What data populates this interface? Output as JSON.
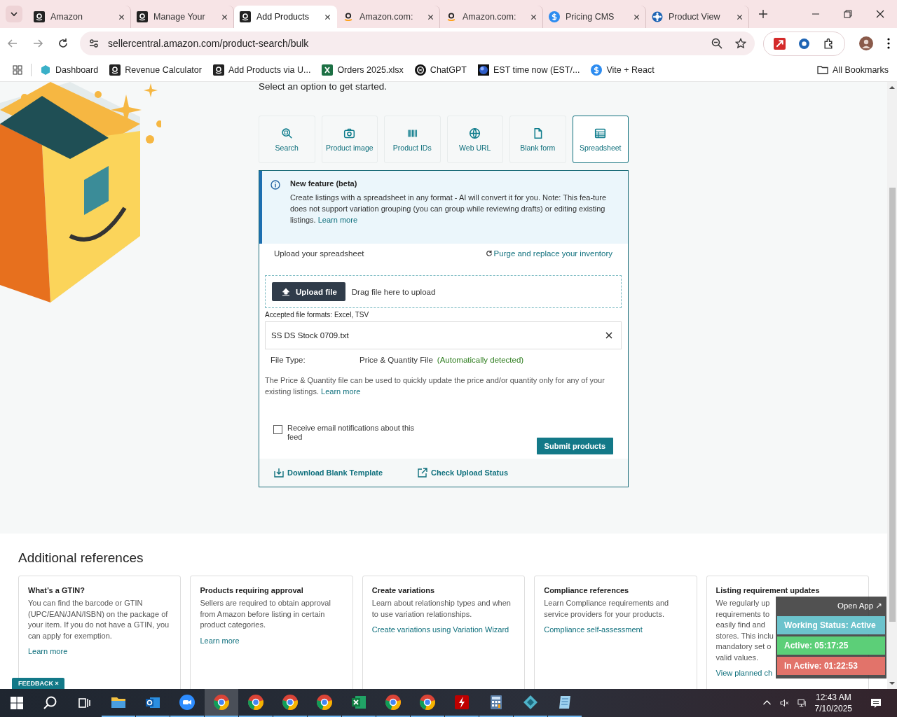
{
  "browser": {
    "tabs": [
      {
        "title": "Amazon",
        "selected": false
      },
      {
        "title": "Manage Your",
        "selected": false
      },
      {
        "title": "Add Products",
        "selected": true
      },
      {
        "title": "Amazon.com:",
        "selected": false
      },
      {
        "title": "Amazon.com:",
        "selected": false
      },
      {
        "title": "Pricing CMS",
        "selected": false
      },
      {
        "title": "Product View",
        "selected": false
      }
    ],
    "url": "sellercentral.amazon.com/product-search/bulk",
    "bookmarks": [
      {
        "label": "Dashboard"
      },
      {
        "label": "Revenue Calculator"
      },
      {
        "label": "Add Products via U..."
      },
      {
        "label": "Orders 2025.xlsx"
      },
      {
        "label": "ChatGPT"
      },
      {
        "label": "EST time now (EST/..."
      },
      {
        "label": "Vite + React"
      }
    ],
    "all_bookmarks": "All Bookmarks"
  },
  "page": {
    "intro": "Select an option to get started.",
    "options": [
      {
        "label": "Search",
        "selected": false
      },
      {
        "label": "Product image",
        "selected": false
      },
      {
        "label": "Product IDs",
        "selected": false
      },
      {
        "label": "Web URL",
        "selected": false
      },
      {
        "label": "Blank form",
        "selected": false
      },
      {
        "label": "Spreadsheet",
        "selected": true
      }
    ],
    "notice": {
      "title": "New feature (beta)",
      "text": "Create listings with a spreadsheet in any format - AI will convert it for you. Note: This fea-ture does not support variation grouping (you can group while reviewing drafts) or editing existing listings.",
      "link": "Learn more"
    },
    "upload": {
      "heading": "Upload your spreadsheet",
      "purge_link": "Purge and replace your inventory",
      "button": "Upload file",
      "drag_text": "Drag file here to upload",
      "accepted": "Accepted file formats: Excel, TSV",
      "file_name": "SS DS Stock 0709.txt",
      "file_type_label": "File Type:",
      "file_type_value": "Price & Quantity File",
      "detected": "(Automatically detected)",
      "description": "The Price & Quantity file can be used to quickly update the price and/or quantity only for any of your existing listings.",
      "learn_more": "Learn more",
      "notify": {
        "label": "Receive email notifications about this feed",
        "checked": false
      },
      "submit": "Submit products",
      "download_link": "Download Blank Template",
      "status_link": "Check Upload Status"
    },
    "references": {
      "title": "Additional references",
      "cards": [
        {
          "title": "What’s a GTIN?",
          "text": "You can find the barcode or GTIN (UPC/EAN/JAN/ISBN) on the package of your item. If you do not have a GTIN, you can apply for exemption.",
          "link": "Learn more"
        },
        {
          "title": "Products requiring approval",
          "text": "Sellers are required to obtain approval from Amazon before listing in certain product categories.",
          "link": "Learn more"
        },
        {
          "title": "Create variations",
          "text": "Learn about relationship types and when to use variation relationships.",
          "link": "Create variations using Variation Wizard"
        },
        {
          "title": "Compliance references",
          "text": "Learn Compliance requirements and service providers for your products.",
          "link": "Compliance self-assessment"
        },
        {
          "title": "Listing requirement updates",
          "lines": [
            "We regularly up",
            "requirements to",
            "easily find and",
            "stores. This inclu",
            "mandatory set o",
            "valid values."
          ],
          "link": "View planned ch"
        }
      ]
    },
    "feedback": "FEEDBACK ×"
  },
  "tracker": {
    "open_app": "Open App ↗",
    "statuses": [
      {
        "text": "Working Status: Active",
        "color": "#6cc3cc"
      },
      {
        "text": "Active: 05:17:25",
        "color": "#5ccf78"
      },
      {
        "text": "In Active: 01:22:53",
        "color": "#e2736a"
      }
    ]
  },
  "taskbar": {
    "apps": [
      {
        "kind": "explorer",
        "selected": false
      },
      {
        "kind": "outlook",
        "selected": false
      },
      {
        "kind": "zoom",
        "selected": false
      },
      {
        "kind": "chrome",
        "selected": true
      },
      {
        "kind": "chrome",
        "selected": false
      },
      {
        "kind": "chrome",
        "selected": false
      },
      {
        "kind": "chrome",
        "selected": false
      },
      {
        "kind": "excel",
        "selected": false
      },
      {
        "kind": "chrome",
        "selected": false
      },
      {
        "kind": "chrome",
        "selected": false
      },
      {
        "kind": "filezilla",
        "selected": false
      },
      {
        "kind": "calculator",
        "selected": false
      },
      {
        "kind": "diamond",
        "selected": false
      },
      {
        "kind": "notepad",
        "selected": false
      }
    ],
    "time": "12:43 AM",
    "date": "7/10/2025"
  }
}
